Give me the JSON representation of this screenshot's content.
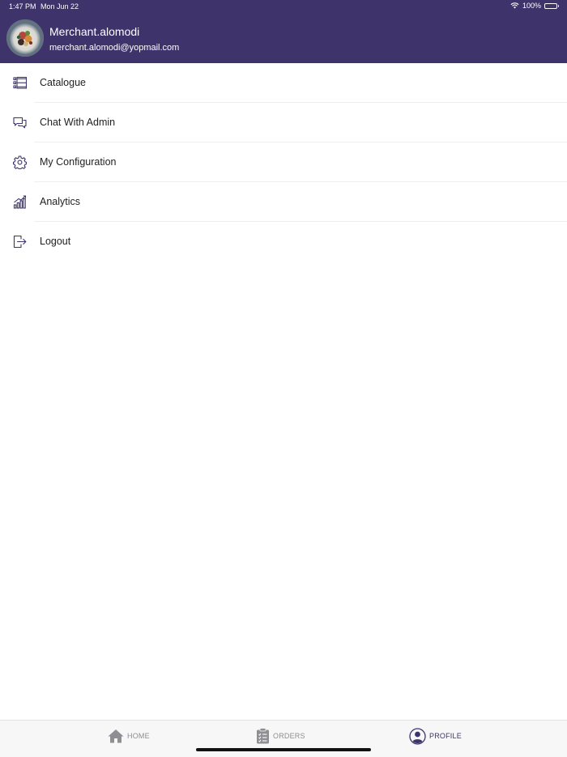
{
  "status_bar": {
    "time": "1:47 PM",
    "date": "Mon Jun 22",
    "battery": "100%"
  },
  "profile": {
    "name": "Merchant.alomodi",
    "email": "merchant.alomodi@yopmail.com"
  },
  "menu": {
    "items": [
      {
        "label": "Catalogue",
        "icon": "list-icon"
      },
      {
        "label": "Chat With Admin",
        "icon": "chat-icon"
      },
      {
        "label": "My Configuration",
        "icon": "gear-icon"
      },
      {
        "label": "Analytics",
        "icon": "analytics-icon"
      },
      {
        "label": "Logout",
        "icon": "logout-icon"
      }
    ]
  },
  "tabs": [
    {
      "label": "HOME",
      "icon": "home-icon",
      "active": false
    },
    {
      "label": "ORDERS",
      "icon": "clipboard-icon",
      "active": false
    },
    {
      "label": "PROFILE",
      "icon": "profile-icon",
      "active": true
    }
  ],
  "colors": {
    "header_bg": "#3e336b",
    "active_tab": "#3e336b",
    "inactive_tab": "#8e8e93",
    "icon": "#3e336b"
  }
}
